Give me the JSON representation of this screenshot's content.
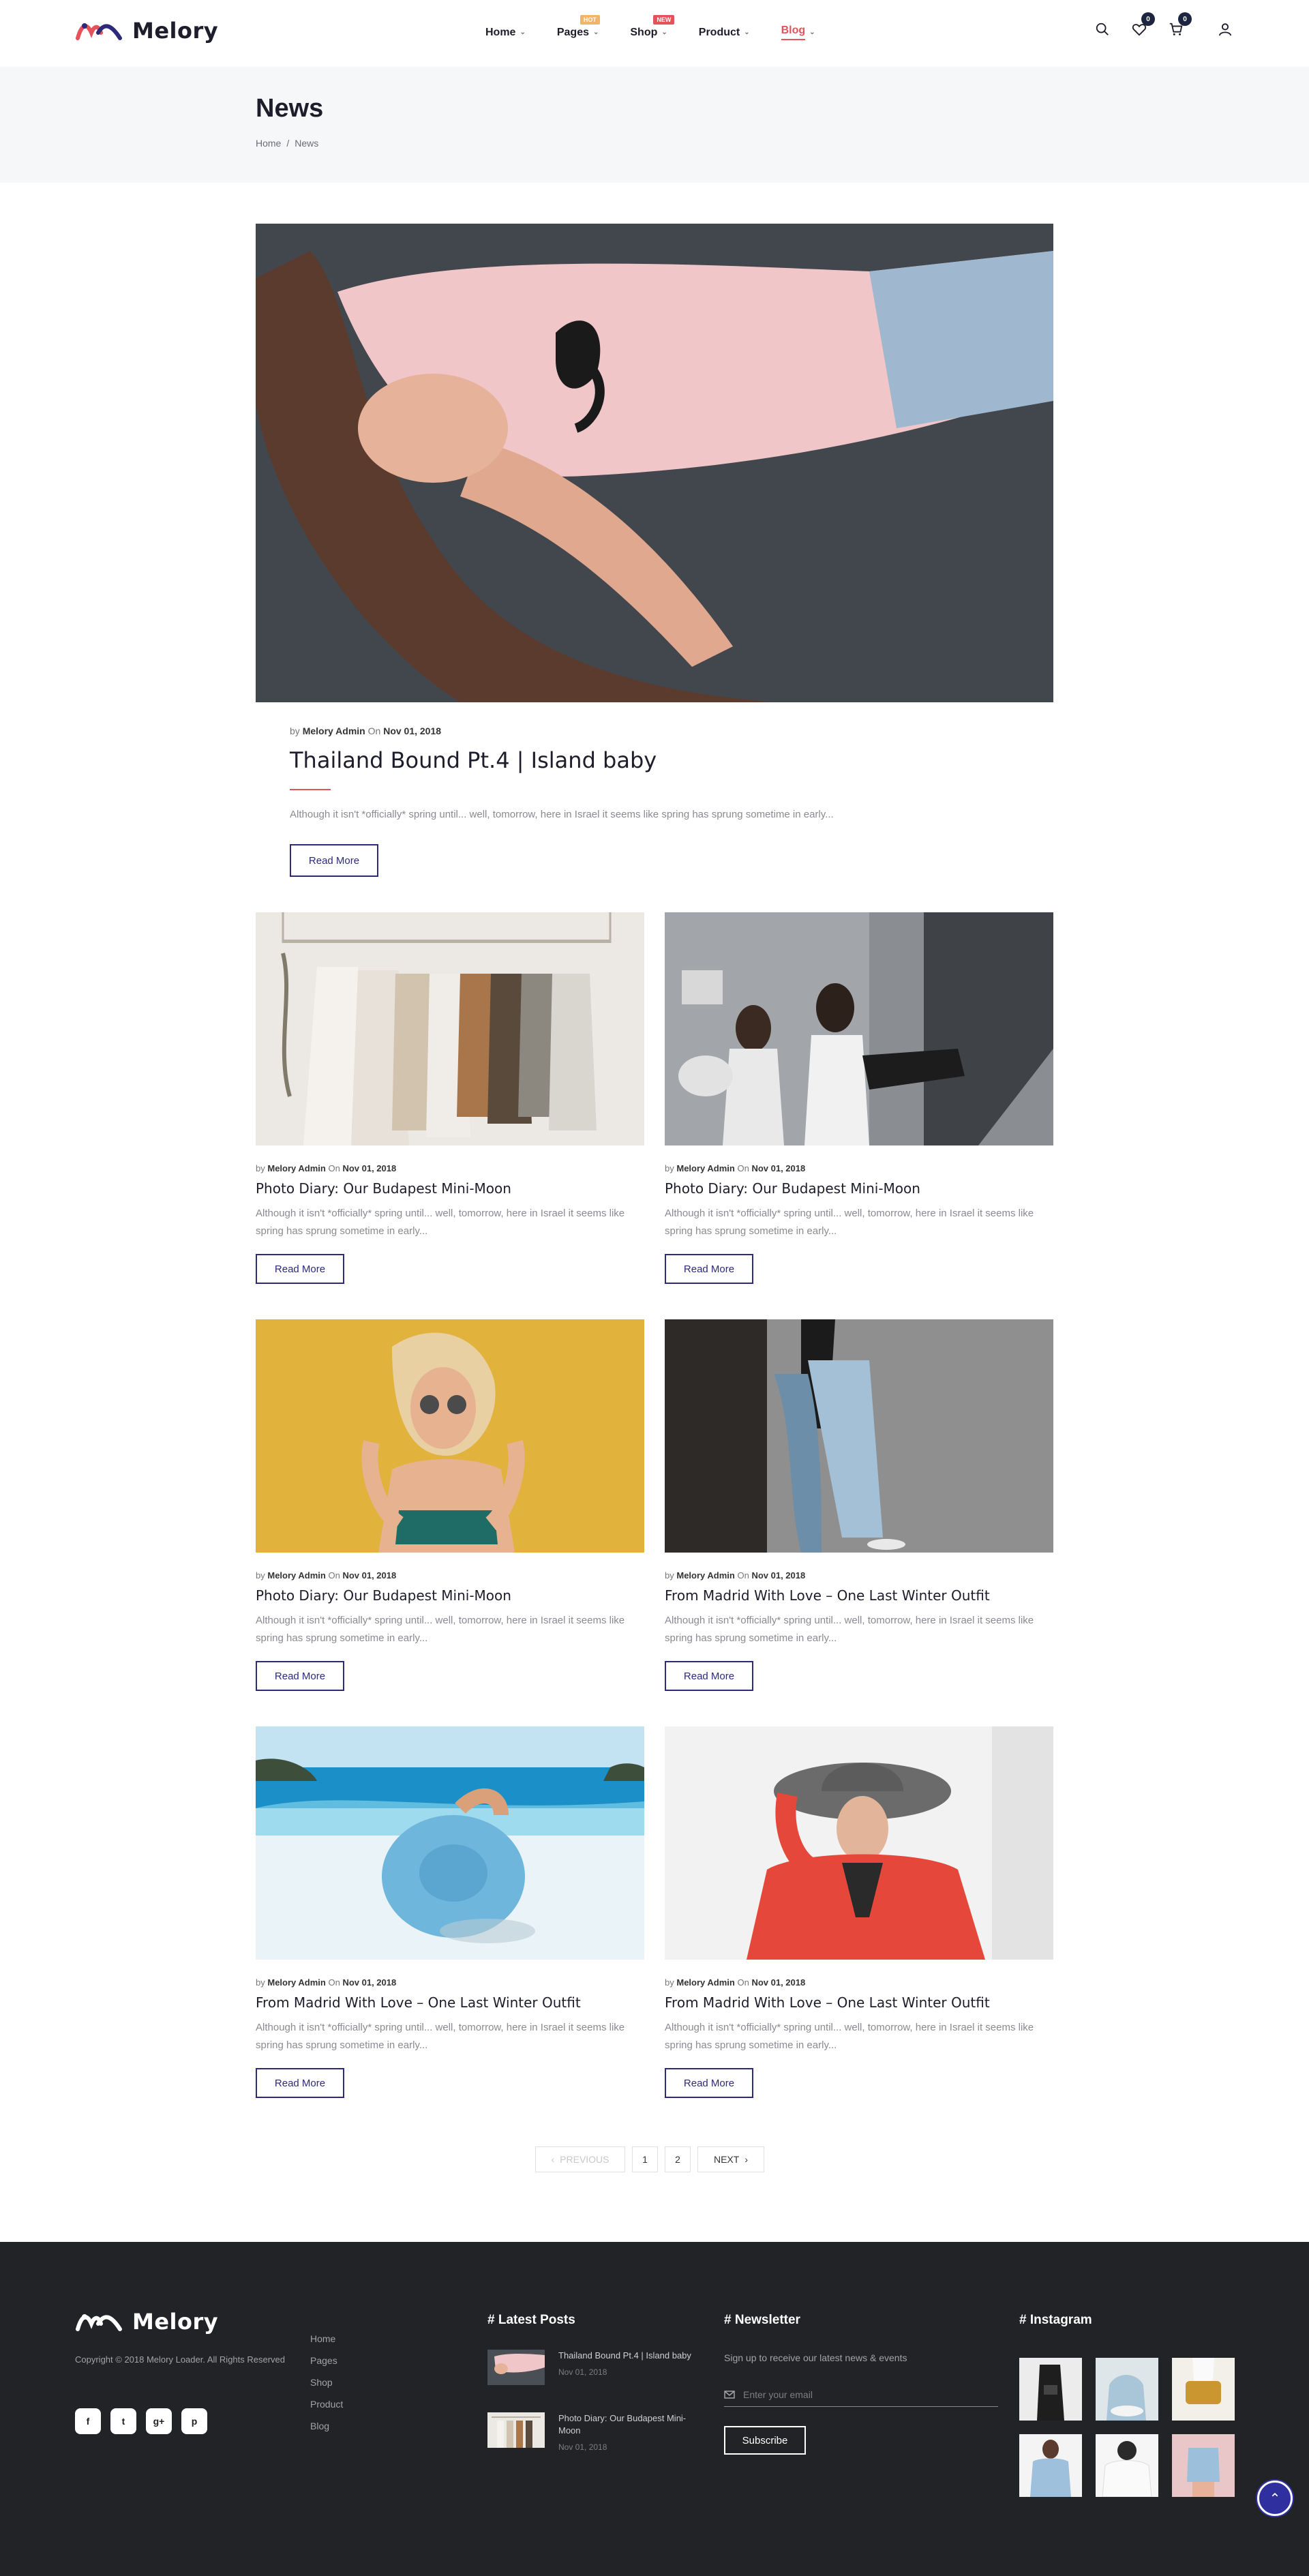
{
  "brand": {
    "name": "Melory",
    "accent": "#e5525a",
    "navy": "#2d2a7a"
  },
  "nav": {
    "items": [
      {
        "label": "Home",
        "badge": ""
      },
      {
        "label": "Pages",
        "badge": "HOT"
      },
      {
        "label": "Shop",
        "badge": "NEW"
      },
      {
        "label": "Product",
        "badge": ""
      },
      {
        "label": "Blog",
        "badge": ""
      }
    ],
    "wishlist_count": "0",
    "cart_count": "0"
  },
  "page": {
    "title": "News",
    "breadcrumb": [
      "Home",
      "/",
      "News"
    ]
  },
  "featured": {
    "meta_by": "by",
    "author": "Melory Admin",
    "meta_on": "On",
    "date": "Nov 01, 2018",
    "title": "Thailand Bound Pt.4 | Island baby",
    "excerpt": "Although it isn't *officially* spring until... well, tomorrow, here in Israel it seems like spring has sprung sometime in early...",
    "button": "Read More"
  },
  "posts": [
    {
      "author": "Melory Admin",
      "date": "Nov 01, 2018",
      "title": "Photo Diary: Our Budapest Mini-Moon",
      "excerpt": "Although it isn't *officially* spring until... well, tomorrow, here in Israel it seems like spring has sprung sometime in early...",
      "button": "Read More"
    },
    {
      "author": "Melory Admin",
      "date": "Nov 01, 2018",
      "title": "Photo Diary: Our Budapest Mini-Moon",
      "excerpt": "Although it isn't *officially* spring until... well, tomorrow, here in Israel it seems like spring has sprung sometime in early...",
      "button": "Read More"
    },
    {
      "author": "Melory Admin",
      "date": "Nov 01, 2018",
      "title": "Photo Diary: Our Budapest Mini-Moon",
      "excerpt": "Although it isn't *officially* spring until... well, tomorrow, here in Israel it seems like spring has sprung sometime in early...",
      "button": "Read More"
    },
    {
      "author": "Melory Admin",
      "date": "Nov 01, 2018",
      "title": "From Madrid With Love – One Last Winter Outfit",
      "excerpt": "Although it isn't *officially* spring until... well, tomorrow, here in Israel it seems like spring has sprung sometime in early...",
      "button": "Read More"
    },
    {
      "author": "Melory Admin",
      "date": "Nov 01, 2018",
      "title": "From Madrid With Love – One Last Winter Outfit",
      "excerpt": "Although it isn't *officially* spring until... well, tomorrow, here in Israel it seems like spring has sprung sometime in early...",
      "button": "Read More"
    },
    {
      "author": "Melory Admin",
      "date": "Nov 01, 2018",
      "title": "From Madrid With Love – One Last Winter Outfit",
      "excerpt": "Although it isn't *officially* spring until... well, tomorrow, here in Israel it seems like spring has sprung sometime in early...",
      "button": "Read More"
    }
  ],
  "meta_words": {
    "by": "by",
    "on": "On"
  },
  "pagination": {
    "previous": "PREVIOUS",
    "pages": [
      "1",
      "2"
    ],
    "next": "NEXT"
  },
  "footer": {
    "copyright": "Copyright © 2018 Melory Loader. All Rights Reserved",
    "links": [
      "Home",
      "Pages",
      "Shop",
      "Product",
      "Blog"
    ],
    "social": [
      "f",
      "t",
      "g+",
      "p"
    ],
    "latest_heading": "# Latest Posts",
    "latest_posts": [
      {
        "title": "Thailand Bound Pt.4 | Island baby",
        "date": "Nov 01, 2018"
      },
      {
        "title": "Photo Diary: Our Budapest Mini-Moon",
        "date": "Nov 01, 2018"
      }
    ],
    "newsletter_heading": "# Newsletter",
    "newsletter_text": "Sign up to receive our latest news & events",
    "email_placeholder": "Enter your email",
    "subscribe": "Subscribe",
    "instagram_heading": "# Instagram"
  }
}
